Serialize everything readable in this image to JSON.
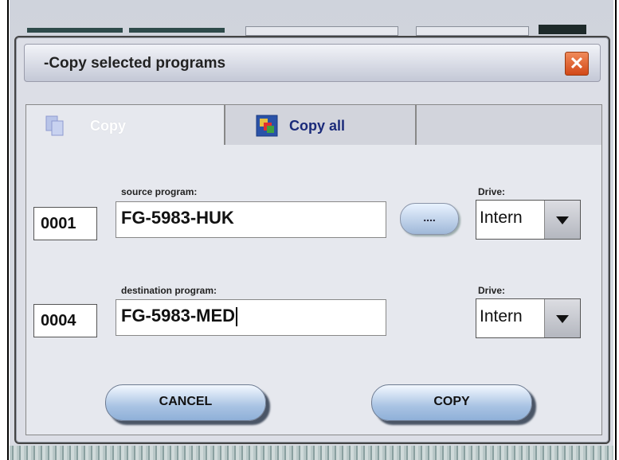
{
  "dialog": {
    "title": "-Copy selected programs",
    "close_label": "✕"
  },
  "tabs": [
    {
      "label": "Copy",
      "active": true,
      "icon": "copy-pages-icon"
    },
    {
      "label": "Copy all",
      "active": false,
      "icon": "copy-all-icon"
    },
    {
      "label": "",
      "active": false
    }
  ],
  "source": {
    "label": "source program:",
    "number": "0001",
    "program": "FG-5983-HUK",
    "drive_label": "Drive:",
    "drive_value": "Intern",
    "browse_label": "...."
  },
  "destination": {
    "label": "destination program:",
    "number": "0004",
    "program": "FG-5983-MED",
    "drive_label": "Drive:",
    "drive_value": "Intern"
  },
  "buttons": {
    "cancel": "CANCEL",
    "copy": "COPY"
  },
  "colors": {
    "close_button": "#e0602a",
    "pill_button": "#a9c3e3",
    "tab_active_text": "#ffffff",
    "tab_text": "#1a2a7a"
  }
}
